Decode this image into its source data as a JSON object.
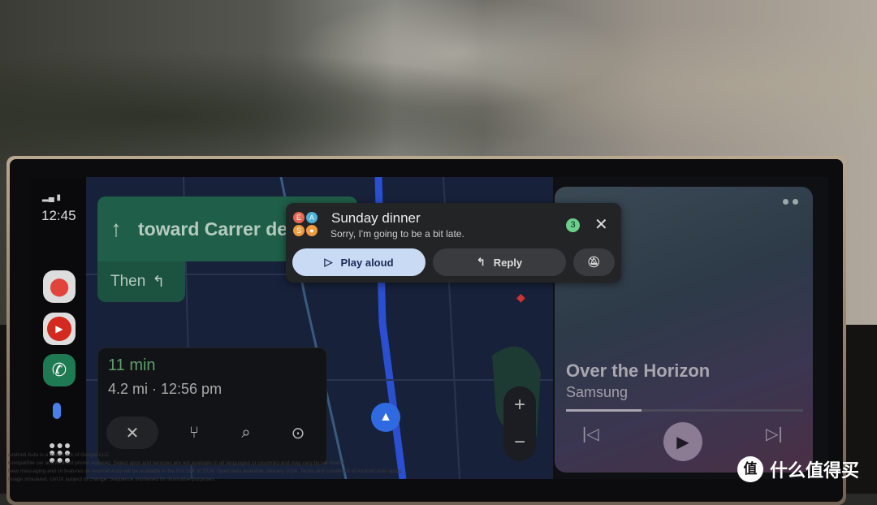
{
  "status": {
    "time": "12:45"
  },
  "sidebar": {
    "apps": [
      {
        "name": "Google Maps",
        "icon": "maps-pin-icon"
      },
      {
        "name": "YouTube Music",
        "icon": "play-icon"
      },
      {
        "name": "Phone",
        "icon": "phone-icon"
      },
      {
        "name": "Assistant",
        "icon": "microphone-icon"
      },
      {
        "name": "App launcher",
        "icon": "grid-icon"
      }
    ]
  },
  "navigation": {
    "direction": "toward Carrer de",
    "then_label": "Then",
    "eta_time": "11 min",
    "eta_details": "4.2 mi · 12:56 pm",
    "zoom_in": "+",
    "zoom_out": "−"
  },
  "notification": {
    "title": "Sunday dinner",
    "message": "Sorry, I'm going to be a bit late.",
    "count": "3",
    "avatars": [
      "E",
      "A",
      "S"
    ],
    "play_label": "Play aloud",
    "reply_label": "Reply"
  },
  "media": {
    "title": "Over the Horizon",
    "artist": "Samsung",
    "progress": 0.32
  },
  "disclaimer": [
    "Android Auto is a trademark of Google LLC.",
    "Compatible car and Android phone required. Select apps and services are not available in all languages or countries and may vary by car model.",
    "New messaging and UI features on Android Auto will be available in the first half of 2024. Open beta available January 2024. Terms and conditions of Android Auto apply.",
    "Image simulated. UI/UX subject to change. Sequence shortened for illustrative purposes."
  ],
  "watermark": {
    "logo": "值",
    "text": "什么值得买"
  },
  "colors": {
    "nav_green": "#1f5e48",
    "eta_green": "#5f9e6b",
    "play_button": "#c9daf5",
    "badge": "#6ccf8a"
  }
}
